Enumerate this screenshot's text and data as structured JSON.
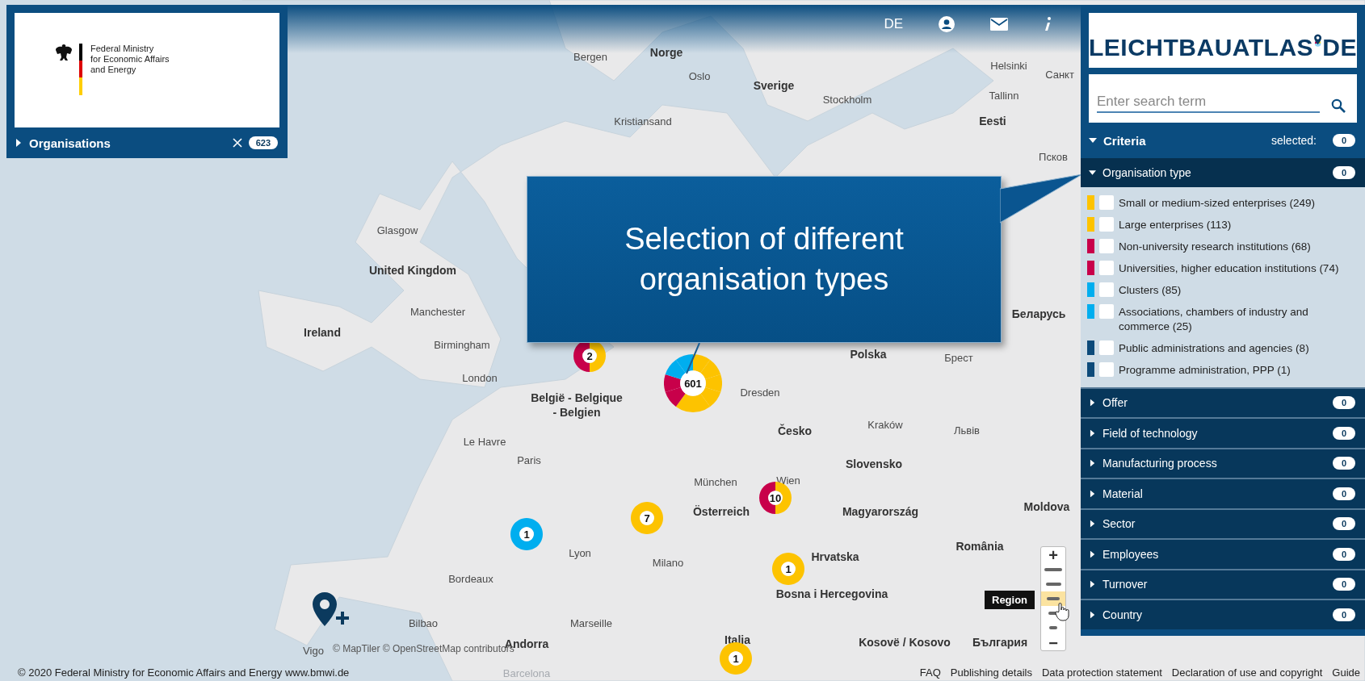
{
  "top_bar": {
    "language": "DE"
  },
  "ministry_panel": {
    "logo_lines": [
      "Federal Ministry",
      "for Economic Affairs",
      "and Energy"
    ],
    "layer": {
      "label": "Organisations",
      "count": "623",
      "expanded": false
    }
  },
  "brand": {
    "name_left": "LEICHTBAUATLAS",
    "name_right": "DE"
  },
  "search": {
    "placeholder": "Enter search term"
  },
  "criteria": {
    "label": "Criteria",
    "expanded": true,
    "selected_label": "selected:",
    "selected_count": "0"
  },
  "categories": [
    {
      "label": "Organisation type",
      "count": "0",
      "expanded": true,
      "options": [
        {
          "label": "Small or medium-sized enterprises (249)",
          "color": "#fdc300",
          "checked": false
        },
        {
          "label": "Large enterprises (113)",
          "color": "#fdc300",
          "checked": false
        },
        {
          "label": "Non-university research institutions (68)",
          "color": "#c8004a",
          "checked": false
        },
        {
          "label": "Universities, higher education institutions (74)",
          "color": "#c8004a",
          "checked": false
        },
        {
          "label": "Clusters (85)",
          "color": "#00aeef",
          "checked": false
        },
        {
          "label": "Associations, chambers of industry and commerce (25)",
          "color": "#00aeef",
          "checked": false
        },
        {
          "label": "Public administrations and agencies (8)",
          "color": "#0c4a7a",
          "checked": false
        },
        {
          "label": "Programme administration, PPP (1)",
          "color": "#0c4a7a",
          "checked": false
        }
      ]
    },
    {
      "label": "Offer",
      "count": "0",
      "expanded": false
    },
    {
      "label": "Field of technology",
      "count": "0",
      "expanded": false
    },
    {
      "label": "Manufacturing process",
      "count": "0",
      "expanded": false
    },
    {
      "label": "Material",
      "count": "0",
      "expanded": false
    },
    {
      "label": "Sector",
      "count": "0",
      "expanded": false
    },
    {
      "label": "Employees",
      "count": "0",
      "expanded": false
    },
    {
      "label": "Turnover",
      "count": "0",
      "expanded": false
    },
    {
      "label": "Country",
      "count": "0",
      "expanded": false
    }
  ],
  "map": {
    "places": [
      {
        "name": "Bergen",
        "kind": "city"
      },
      {
        "name": "Norge",
        "kind": "country"
      },
      {
        "name": "Oslo",
        "kind": "city"
      },
      {
        "name": "Sverige",
        "kind": "country"
      },
      {
        "name": "Stockholm",
        "kind": "city"
      },
      {
        "name": "Helsinki",
        "kind": "city"
      },
      {
        "name": "Tallinn",
        "kind": "city"
      },
      {
        "name": "Eesti",
        "kind": "country"
      },
      {
        "name": "Kristiansand",
        "kind": "city"
      },
      {
        "name": "Санкт",
        "kind": "city"
      },
      {
        "name": "Псков",
        "kind": "city"
      },
      {
        "name": "Glasgow",
        "kind": "city"
      },
      {
        "name": "United Kingdom",
        "kind": "country"
      },
      {
        "name": "Manchester",
        "kind": "city"
      },
      {
        "name": "Ireland",
        "kind": "country"
      },
      {
        "name": "Birmingham",
        "kind": "city"
      },
      {
        "name": "London",
        "kind": "city"
      },
      {
        "name": "België - Belgique",
        "kind": "country"
      },
      {
        "name": "- Belgien",
        "kind": "country"
      },
      {
        "name": "Dresden",
        "kind": "city"
      },
      {
        "name": "Polska",
        "kind": "country"
      },
      {
        "name": "Беларусь",
        "kind": "country"
      },
      {
        "name": "Брест",
        "kind": "city"
      },
      {
        "name": "Česko",
        "kind": "country"
      },
      {
        "name": "Kraków",
        "kind": "city"
      },
      {
        "name": "Львів",
        "kind": "city"
      },
      {
        "name": "Le Havre",
        "kind": "city"
      },
      {
        "name": "Paris",
        "kind": "city"
      },
      {
        "name": "Slovensko",
        "kind": "country"
      },
      {
        "name": "München",
        "kind": "city"
      },
      {
        "name": "Wien",
        "kind": "city"
      },
      {
        "name": "Österreich",
        "kind": "country"
      },
      {
        "name": "Magyarország",
        "kind": "country"
      },
      {
        "name": "Moldova",
        "kind": "country"
      },
      {
        "name": "Lyon",
        "kind": "city"
      },
      {
        "name": "Milano",
        "kind": "city"
      },
      {
        "name": "Hrvatska",
        "kind": "country"
      },
      {
        "name": "România",
        "kind": "country"
      },
      {
        "name": "Bordeaux",
        "kind": "city"
      },
      {
        "name": "Bosna i Hercegovina",
        "kind": "country"
      },
      {
        "name": "Bilbao",
        "kind": "city"
      },
      {
        "name": "Marseille",
        "kind": "city"
      },
      {
        "name": "Andorra",
        "kind": "country"
      },
      {
        "name": "Italia",
        "kind": "country"
      },
      {
        "name": "Kosovë / Kosovo",
        "kind": "country"
      },
      {
        "name": "България",
        "kind": "country"
      },
      {
        "name": "Vigo",
        "kind": "city"
      },
      {
        "name": "Barcelona",
        "kind": "faded"
      }
    ],
    "clusters": [
      {
        "count": "2",
        "segments": [
          {
            "color": "#fdc300"
          },
          {
            "color": "#c8004a"
          }
        ]
      },
      {
        "count": "601",
        "segments": [
          {
            "color": "#fdc300"
          },
          {
            "color": "#fdc300"
          },
          {
            "color": "#fdc300"
          },
          {
            "color": "#fdc300"
          },
          {
            "color": "#fdc300"
          },
          {
            "color": "#fdc300"
          },
          {
            "color": "#c8004a"
          },
          {
            "color": "#c8004a"
          },
          {
            "color": "#00aeef"
          },
          {
            "color": "#00aeef"
          }
        ]
      },
      {
        "count": "10",
        "segments": [
          {
            "color": "#fdc300"
          },
          {
            "color": "#c8004a"
          }
        ]
      },
      {
        "count": "7",
        "segments": [
          {
            "color": "#fdc300"
          }
        ]
      },
      {
        "count": "1",
        "segments": [
          {
            "color": "#00aeef"
          }
        ]
      },
      {
        "count": "1",
        "segments": [
          {
            "color": "#fdc300"
          }
        ]
      },
      {
        "count": "1",
        "segments": [
          {
            "color": "#fdc300"
          }
        ]
      }
    ],
    "attribution": "© MapTiler © OpenStreetMap contributors",
    "zoom": {
      "zoom_in": "+",
      "zoom_out": "−",
      "levels": [
        {
          "selected": false
        },
        {
          "selected": false
        },
        {
          "selected": true
        },
        {
          "selected": false
        },
        {
          "selected": false
        }
      ],
      "tooltip": "Region"
    }
  },
  "callout": {
    "text": "Selection of different organisation types"
  },
  "footer": {
    "copyright": "© 2020 Federal Ministry for Economic Affairs and Energy www.bmwi.de",
    "links": [
      "FAQ",
      "Publishing details",
      "Data protection statement",
      "Declaration of use and copyright",
      "Guide"
    ]
  }
}
